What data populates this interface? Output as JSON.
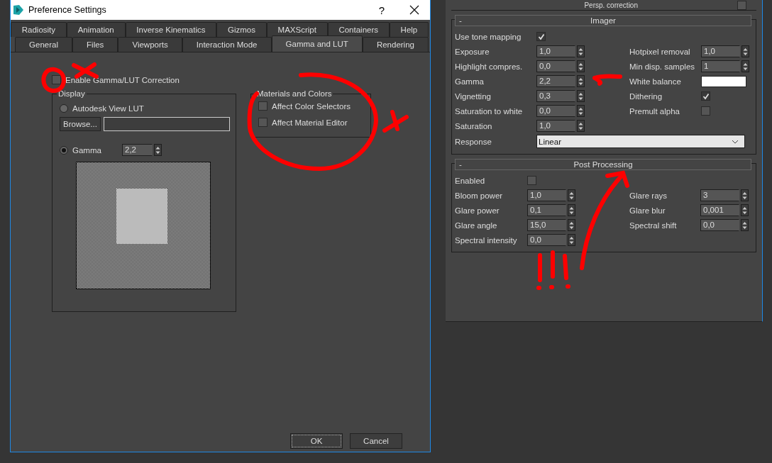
{
  "dialog": {
    "title": "Preference Settings",
    "help": "?",
    "tab_rows": [
      [
        {
          "label": "Radiosity",
          "selected": false
        },
        {
          "label": "Animation",
          "selected": false
        },
        {
          "label": "Inverse Kinematics",
          "selected": false
        },
        {
          "label": "Gizmos",
          "selected": false
        },
        {
          "label": "MAXScript",
          "selected": false
        },
        {
          "label": "Containers",
          "selected": false
        },
        {
          "label": "Help",
          "selected": false
        }
      ],
      [
        {
          "label": "General",
          "selected": false
        },
        {
          "label": "Files",
          "selected": false
        },
        {
          "label": "Viewports",
          "selected": false
        },
        {
          "label": "Interaction Mode",
          "selected": false
        },
        {
          "label": "Gamma and LUT",
          "selected": true
        },
        {
          "label": "Rendering",
          "selected": false
        }
      ]
    ],
    "enable": {
      "label": "Enable Gamma/LUT Correction",
      "checked": false
    },
    "display": {
      "title": "Display",
      "lut": {
        "label": "Autodesk View LUT",
        "selected": false
      },
      "browse": "Browse...",
      "gamma": {
        "label": "Gamma",
        "selected": true,
        "value": "2,2"
      }
    },
    "materials": {
      "title": "Materials and Colors",
      "options": [
        {
          "label": "Affect Color Selectors",
          "checked": false
        },
        {
          "label": "Affect Material Editor",
          "checked": false
        }
      ]
    },
    "buttons": [
      "OK",
      "Cancel"
    ]
  },
  "panel": {
    "top_row": {
      "label": "Persp. correction",
      "checked": false
    },
    "imager": {
      "collapse": "-",
      "title": "Imager",
      "rows": [
        {
          "left": {
            "kind": "check",
            "label": "Use tone mapping",
            "checked": true
          }
        },
        {
          "left": {
            "kind": "spin",
            "label": "Exposure",
            "value": "1,0"
          },
          "right": {
            "kind": "spin",
            "label": "Hotpixel removal",
            "value": "1,0"
          }
        },
        {
          "left": {
            "kind": "spin",
            "label": "Highlight compres.",
            "value": "0,0"
          },
          "right": {
            "kind": "spin",
            "label": "Min disp. samples",
            "value": "1"
          }
        },
        {
          "left": {
            "kind": "spin",
            "label": "Gamma",
            "value": "2,2"
          },
          "right": {
            "kind": "swatch",
            "label": "White balance"
          }
        },
        {
          "left": {
            "kind": "spin",
            "label": "Vignetting",
            "value": "0,3"
          },
          "right": {
            "kind": "check",
            "label": "Dithering",
            "checked": true
          }
        },
        {
          "left": {
            "kind": "spin",
            "label": "Saturation to white",
            "value": "0,0"
          },
          "right": {
            "kind": "check",
            "label": "Premult alpha",
            "checked": false
          }
        },
        {
          "left": {
            "kind": "spin",
            "label": "Saturation",
            "value": "1,0"
          }
        }
      ],
      "response": {
        "label": "Response",
        "value": "Linear"
      }
    },
    "post": {
      "collapse": "-",
      "title": "Post Processing",
      "rows": [
        {
          "left": {
            "kind": "check",
            "label": "Enabled",
            "checked": false
          }
        },
        {
          "left": {
            "kind": "spin",
            "label": "Bloom power",
            "value": "1,0"
          },
          "right": {
            "kind": "spin",
            "label": "Glare rays",
            "value": "3"
          }
        },
        {
          "left": {
            "kind": "spin",
            "label": "Glare power",
            "value": "0,1"
          },
          "right": {
            "kind": "spin",
            "label": "Glare blur",
            "value": "0,001"
          }
        },
        {
          "left": {
            "kind": "spin",
            "label": "Glare angle",
            "value": "15,0"
          },
          "right": {
            "kind": "spin",
            "label": "Spectral shift",
            "value": "0,0"
          }
        },
        {
          "left": {
            "kind": "spin",
            "label": "Spectral intensity",
            "value": "0,0"
          }
        }
      ]
    }
  }
}
